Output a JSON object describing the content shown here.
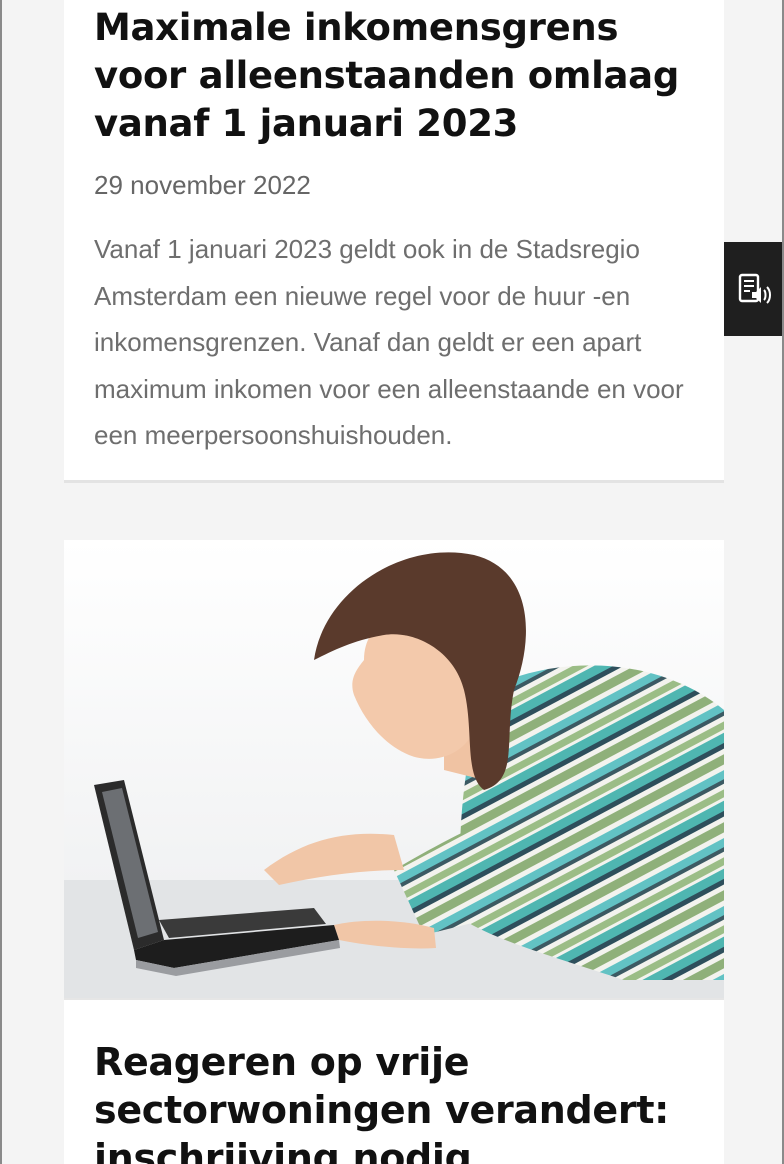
{
  "articles": [
    {
      "title": "Maximale inkomensgrens voor alleenstaanden omlaag vanaf 1 januari 2023",
      "date": "29 november 2022",
      "excerpt": "Vanaf 1 januari 2023 geldt ook in de Stadsregio Amsterdam een nieuwe regel voor de huur -en inkomensgrenzen. Vanaf dan geldt er een apart maximum inkomen voor een alleenstaande en voor een meerpersoonshuishouden."
    },
    {
      "title": "Reageren op vrije sectorwoningen verandert: inschrijving nodig"
    }
  ],
  "readspeaker": {
    "icon": "text-to-speech-icon"
  }
}
